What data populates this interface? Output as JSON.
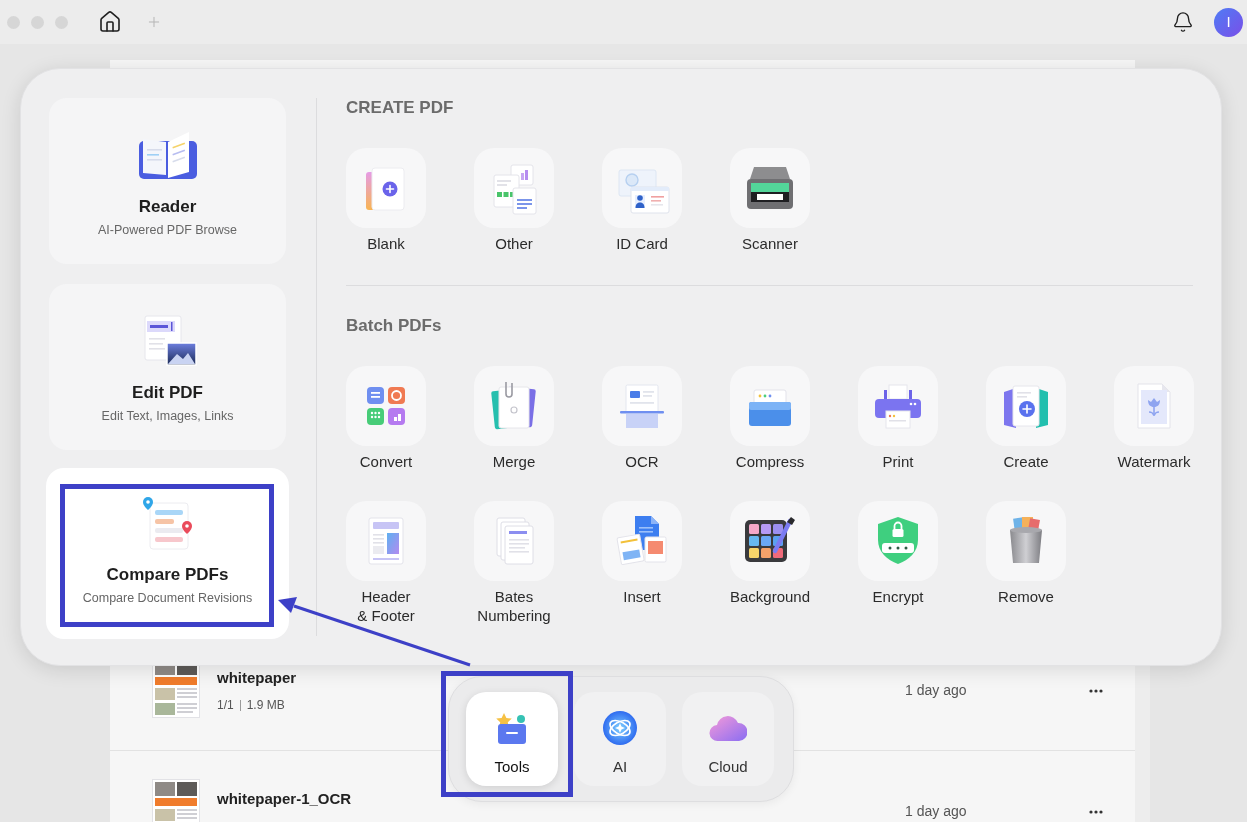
{
  "top_bar": {
    "avatar_initial": "I"
  },
  "feature_cards": [
    {
      "title": "Reader",
      "subtitle": "AI-Powered PDF Browse",
      "selected": false
    },
    {
      "title": "Edit PDF",
      "subtitle": "Edit Text, Images, Links",
      "selected": false
    },
    {
      "title": "Compare PDFs",
      "subtitle": "Compare Document Revisions",
      "selected": true
    }
  ],
  "create_pdf": {
    "heading": "CREATE PDF",
    "items": [
      "Blank",
      "Other",
      "ID Card",
      "Scanner"
    ]
  },
  "batch_pdfs": {
    "heading": "Batch PDFs",
    "items": [
      "Convert",
      "Merge",
      "OCR",
      "Compress",
      "Print",
      "Create",
      "Watermark",
      "Header\n& Footer",
      "Bates\nNumbering",
      "Insert",
      "Background",
      "Encrypt",
      "Remove"
    ]
  },
  "files": [
    {
      "name": "whitepaper",
      "pages": "1/1",
      "size": "1.9 MB",
      "modified": "1 day ago"
    },
    {
      "name": "whitepaper-1_OCR",
      "modified": "1 day ago"
    }
  ],
  "dock": [
    {
      "label": "Tools",
      "selected": true
    },
    {
      "label": "AI",
      "selected": false
    },
    {
      "label": "Cloud",
      "selected": false
    }
  ]
}
